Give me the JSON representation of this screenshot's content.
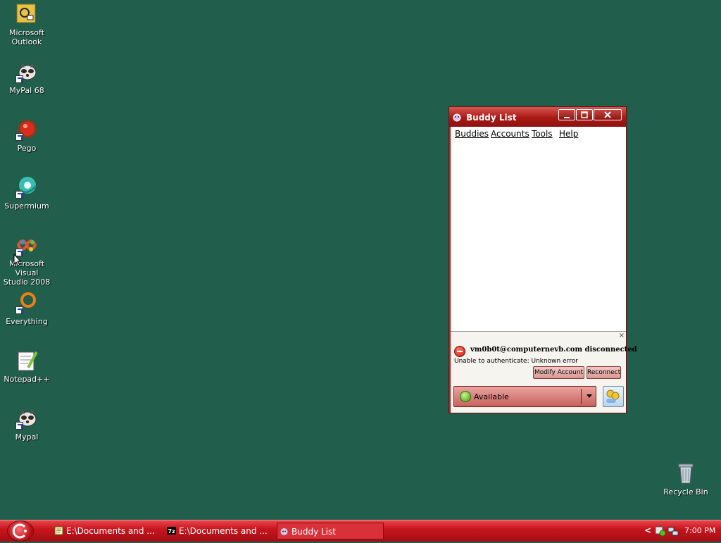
{
  "desktop": {
    "icons": [
      {
        "name": "Microsoft Outlook",
        "line1": "Microsoft",
        "line2": "Outlook"
      },
      {
        "name": "MyPal 68",
        "line1": "MyPal 68",
        "line2": ""
      },
      {
        "name": "Pego",
        "line1": "Pego",
        "line2": ""
      },
      {
        "name": "Supermium",
        "line1": "Supermium",
        "line2": ""
      },
      {
        "name": "Microsoft Visual Studio 2008",
        "line1": "Microsoft Visual",
        "line2": "Studio 2008"
      },
      {
        "name": "Everything",
        "line1": "Everything",
        "line2": ""
      },
      {
        "name": "Notepad++",
        "line1": "Notepad++",
        "line2": ""
      },
      {
        "name": "Mypal",
        "line1": "Mypal",
        "line2": ""
      },
      {
        "name": "Recycle Bin",
        "line1": "Recycle Bin",
        "line2": ""
      }
    ]
  },
  "buddy_window": {
    "title": "Buddy List",
    "menu": [
      "Buddies",
      "Accounts",
      "Tools",
      "Help"
    ],
    "notice": {
      "close": "×",
      "title": "vm0b0t@computernevb.com disconnected",
      "message": "Unable to authenticate: Unknown error",
      "modify_button": "Modify Account",
      "reconnect_button": "Reconnect"
    },
    "status": "Available"
  },
  "taskbar": {
    "tasks": [
      {
        "label": "E:\\Documents and ...",
        "icon": "notepad-icon"
      },
      {
        "label": "E:\\Documents and ...",
        "icon": "7zip-icon"
      },
      {
        "label": "Buddy List",
        "icon": "pidgin-icon"
      }
    ],
    "tray_chevron": "<",
    "clock": "7:00 PM"
  }
}
